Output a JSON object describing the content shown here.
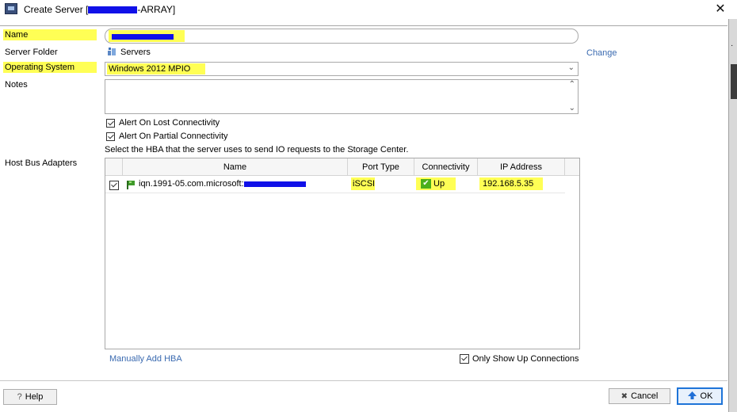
{
  "window": {
    "title_prefix": "Create Server [",
    "title_suffix": "-ARRAY]",
    "close_label": "✕"
  },
  "form": {
    "name_label": "Name",
    "server_folder_label": "Server Folder",
    "server_folder_value": "Servers",
    "change_link": "Change",
    "os_label": "Operating System",
    "os_value": "Windows 2012 MPIO",
    "notes_label": "Notes",
    "alert_lost_label": "Alert On Lost Connectivity",
    "alert_partial_label": "Alert On Partial Connectivity",
    "hba_instruction": "Select the HBA that the server uses to send IO requests to the Storage Center.",
    "hba_label": "Host Bus Adapters"
  },
  "hba_table": {
    "columns": [
      "Name",
      "Port Type",
      "Connectivity",
      "IP Address"
    ],
    "rows": [
      {
        "name": "iqn.1991-05.com.microsoft:",
        "port_type": "iSCSI",
        "connectivity": "Up",
        "ip": "192.168.5.35"
      }
    ],
    "manual_add_link": "Manually Add HBA",
    "only_up_label": "Only Show Up Connections"
  },
  "footer": {
    "help_label": "Help",
    "help_icon": "?",
    "cancel_label": "Cancel",
    "cancel_icon": "✖",
    "ok_label": "OK"
  },
  "colors": {
    "highlight": "#ffff33",
    "redaction": "#1010e8",
    "link": "#3a6ab0",
    "ok_arrow": "#1f6fd6",
    "status_up": "#4caf1a"
  }
}
